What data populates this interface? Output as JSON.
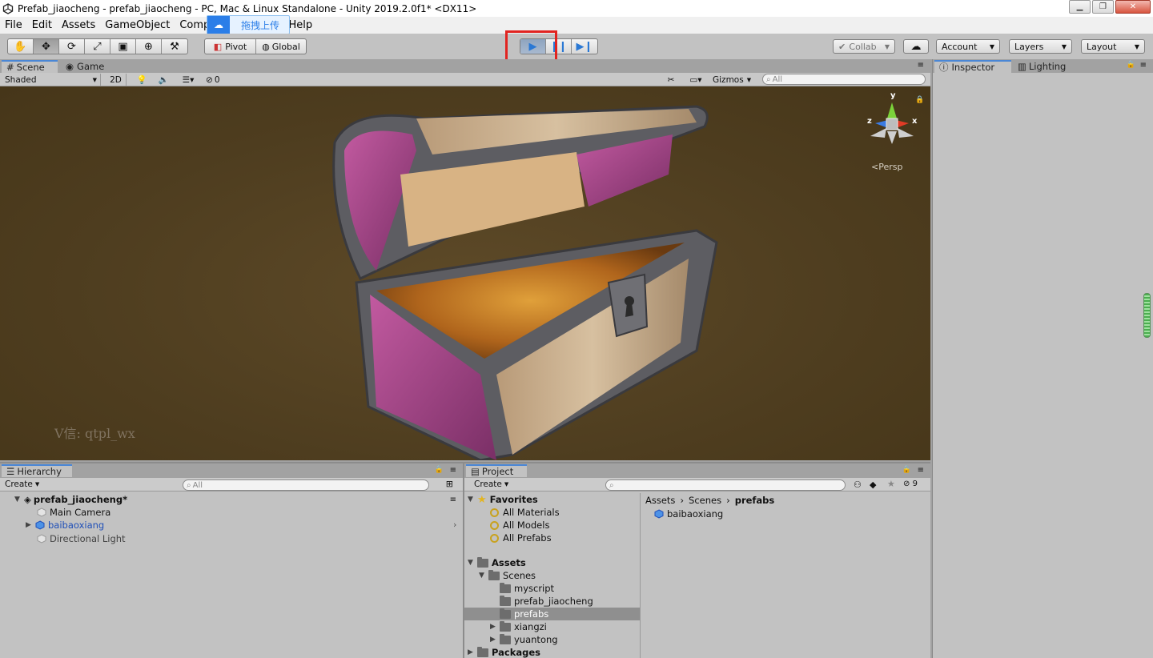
{
  "window": {
    "title": "Prefab_jiaocheng - prefab_jiaocheng - PC, Mac & Linux Standalone - Unity 2019.2.0f1* <DX11>"
  },
  "menu": [
    "File",
    "Edit",
    "Assets",
    "GameObject",
    "Compon",
    "Help"
  ],
  "upload_badge": {
    "label": "拖拽上传"
  },
  "toolbar": {
    "pivot_label": "Pivot",
    "global_label": "Global",
    "collab_label": "Collab",
    "account_label": "Account",
    "layers_label": "Layers",
    "layout_label": "Layout"
  },
  "scene_panel": {
    "tabs": [
      "Scene",
      "Game"
    ],
    "shading_mode": "Shaded",
    "mode_2d": "2D",
    "hidden_count": "0",
    "gizmos_label": "Gizmos",
    "search_placeholder": "All",
    "persp_label": "Persp",
    "watermark": "V信: qtpl_wx",
    "gizmo_axes": {
      "y": "y",
      "x": "x",
      "z": "z"
    }
  },
  "inspector_panel": {
    "tabs": [
      "Inspector",
      "Lighting"
    ]
  },
  "hierarchy": {
    "tab": "Hierarchy",
    "create_label": "Create",
    "search_placeholder": "All",
    "scene_name": "prefab_jiaocheng*",
    "items": [
      "Main Camera",
      "baibaoxiang",
      "Directional Light"
    ]
  },
  "project": {
    "tab": "Project",
    "create_label": "Create",
    "hidden_count": "9",
    "favorites": {
      "label": "Favorites",
      "items": [
        "All Materials",
        "All Models",
        "All Prefabs"
      ]
    },
    "assets_label": "Assets",
    "scenes_label": "Scenes",
    "scene_folders": [
      "myscript",
      "prefab_jiaocheng",
      "prefabs",
      "xiangzi",
      "yuantong"
    ],
    "packages_label": "Packages",
    "breadcrumb": [
      "Assets",
      "Scenes",
      "prefabs"
    ],
    "asset_items": [
      "baibaoxiang"
    ]
  },
  "colors": {
    "accent": "#4a87d6",
    "highlight": "#e12420",
    "prefab_blue": "#1f4fb8",
    "viewport_bg": "#4e3d1f"
  }
}
